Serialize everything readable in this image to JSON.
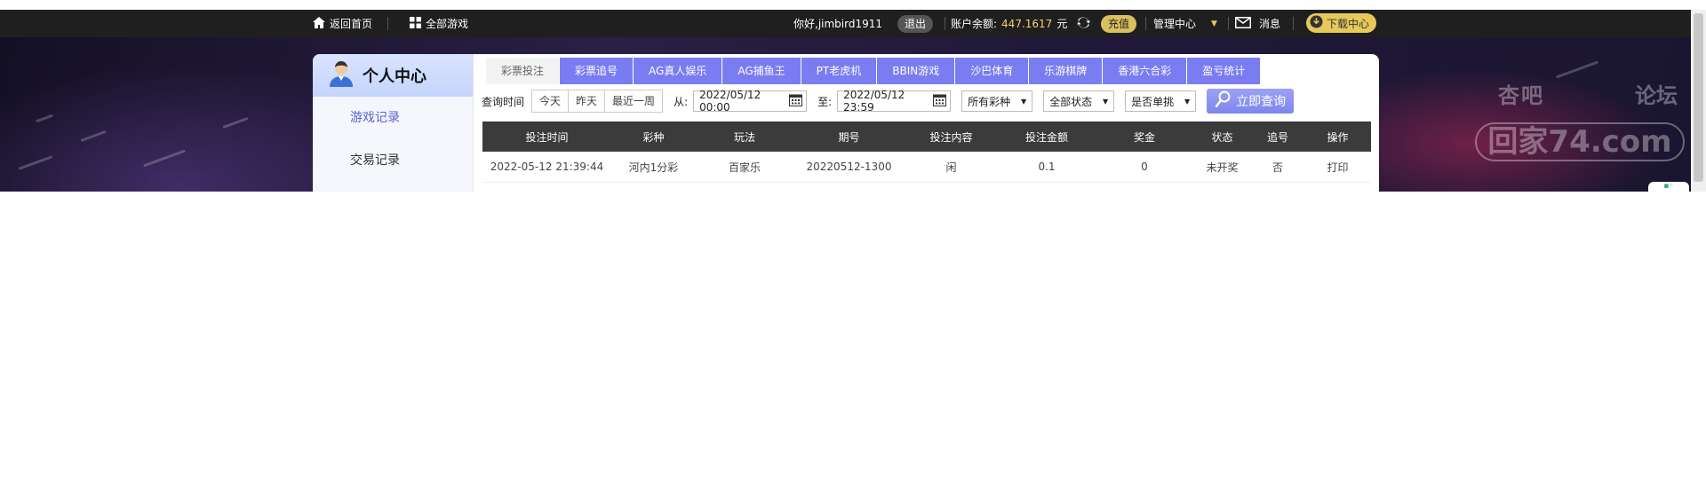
{
  "topbar": {
    "home_label": "返回首页",
    "all_games_label": "全部游戏",
    "greeting": "你好,jimbird1911",
    "logout_label": "退出",
    "balance_label": "账户余额:",
    "balance_value": "447.1617",
    "balance_unit": "元",
    "recharge_label": "充值",
    "admin_label": "管理中心",
    "message_label": "消息",
    "download_label": "下载中心"
  },
  "watermark": {
    "line1a": "杏吧",
    "line1b": "论坛",
    "line2": "回家74.com"
  },
  "sidebar": {
    "title": "个人中心",
    "items": [
      {
        "label": "游戏记录"
      },
      {
        "label": "交易记录"
      }
    ]
  },
  "tabs": [
    {
      "label": "彩票投注"
    },
    {
      "label": "彩票追号"
    },
    {
      "label": "AG真人娱乐"
    },
    {
      "label": "AG捕鱼王"
    },
    {
      "label": "PT老虎机"
    },
    {
      "label": "BBIN游戏"
    },
    {
      "label": "沙巴体育"
    },
    {
      "label": "乐游棋牌"
    },
    {
      "label": "香港六合彩"
    },
    {
      "label": "盈亏统计"
    }
  ],
  "filters": {
    "query_time_label": "查询时间",
    "quick_ranges": [
      "今天",
      "昨天",
      "最近一周"
    ],
    "from_label": "从:",
    "from_value": "2022/05/12 00:00",
    "to_label": "至:",
    "to_value": "2022/05/12 23:59",
    "lottery_select": "所有彩种",
    "status_select": "全部状态",
    "single_select": "是否单挑",
    "search_label": "立即查询"
  },
  "table": {
    "headers": [
      "投注时间",
      "彩种",
      "玩法",
      "期号",
      "投注内容",
      "投注金额",
      "奖金",
      "状态",
      "追号",
      "操作"
    ],
    "rows": [
      [
        "2022-05-12 21:39:44",
        "河内1分彩",
        "百家乐",
        "20220512-1300",
        "闲",
        "0.1",
        "0",
        "未开奖",
        "否",
        "打印"
      ]
    ]
  },
  "colors": {
    "tab": "#7a7cf2",
    "topbar": "#1f1f1f",
    "table_head": "#3b3b3b",
    "balance": "#f1d36a",
    "sidebar_active": "#5861d8"
  },
  "icons": [
    "home-icon",
    "grid-icon",
    "refresh-icon",
    "caret-down-icon",
    "mail-icon",
    "download-icon",
    "user-avatar-icon",
    "calendar-icon",
    "search-key-icon"
  ]
}
